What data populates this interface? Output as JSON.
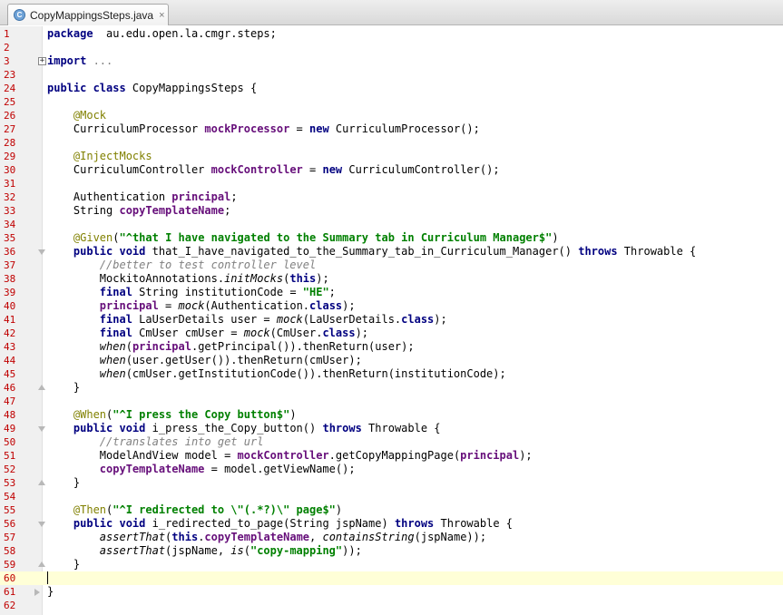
{
  "tab": {
    "icon_letter": "C",
    "title": "CopyMappingsSteps.java",
    "close_glyph": "×"
  },
  "colors": {
    "keyword": "#000080",
    "field": "#660e7a",
    "string": "#008000",
    "annotation": "#808000",
    "comment": "#808080",
    "line_number": "#c00000",
    "current_line": "#ffffd7"
  },
  "lines": [
    {
      "n": "1",
      "fold": "",
      "tokens": [
        [
          "kw",
          "package"
        ],
        [
          "",
          "  au.edu.open.la.cmgr.steps;"
        ]
      ]
    },
    {
      "n": "2",
      "fold": "",
      "tokens": []
    },
    {
      "n": "3",
      "fold": "plus",
      "tokens": [
        [
          "kw",
          "import"
        ],
        [
          "fold-text",
          " ..."
        ]
      ]
    },
    {
      "n": "23",
      "fold": "",
      "tokens": []
    },
    {
      "n": "24",
      "fold": "",
      "tokens": [
        [
          "kw",
          "public class"
        ],
        [
          "",
          " CopyMappingsSteps {"
        ]
      ]
    },
    {
      "n": "25",
      "fold": "",
      "tokens": []
    },
    {
      "n": "26",
      "fold": "",
      "tokens": [
        [
          "",
          "    "
        ],
        [
          "ann",
          "@Mock"
        ]
      ]
    },
    {
      "n": "27",
      "fold": "",
      "tokens": [
        [
          "",
          "    CurriculumProcessor "
        ],
        [
          "fld",
          "mockProcessor"
        ],
        [
          "",
          " = "
        ],
        [
          "kw",
          "new"
        ],
        [
          "",
          " CurriculumProcessor();"
        ]
      ]
    },
    {
      "n": "28",
      "fold": "",
      "tokens": []
    },
    {
      "n": "29",
      "fold": "",
      "tokens": [
        [
          "",
          "    "
        ],
        [
          "ann",
          "@InjectMocks"
        ]
      ]
    },
    {
      "n": "30",
      "fold": "",
      "tokens": [
        [
          "",
          "    CurriculumController "
        ],
        [
          "fld",
          "mockController"
        ],
        [
          "",
          " = "
        ],
        [
          "kw",
          "new"
        ],
        [
          "",
          " CurriculumController();"
        ]
      ]
    },
    {
      "n": "31",
      "fold": "",
      "tokens": []
    },
    {
      "n": "32",
      "fold": "",
      "tokens": [
        [
          "",
          "    Authentication "
        ],
        [
          "fld",
          "principal"
        ],
        [
          "",
          ";"
        ]
      ]
    },
    {
      "n": "33",
      "fold": "",
      "tokens": [
        [
          "",
          "    String "
        ],
        [
          "fld",
          "copyTemplateName"
        ],
        [
          "",
          ";"
        ]
      ]
    },
    {
      "n": "34",
      "fold": "",
      "tokens": []
    },
    {
      "n": "35",
      "fold": "",
      "tokens": [
        [
          "",
          "    "
        ],
        [
          "ann",
          "@Given"
        ],
        [
          "",
          "("
        ],
        [
          "str",
          "\"^that I have navigated to the Summary tab in Curriculum Manager$\""
        ],
        [
          "",
          ")"
        ]
      ]
    },
    {
      "n": "36",
      "fold": "open",
      "tokens": [
        [
          "",
          "    "
        ],
        [
          "kw",
          "public void"
        ],
        [
          "",
          " that_I_have_navigated_to_the_Summary_tab_in_Curriculum_Manager() "
        ],
        [
          "kw",
          "throws"
        ],
        [
          "",
          " Throwable {"
        ]
      ]
    },
    {
      "n": "37",
      "fold": "",
      "tokens": [
        [
          "",
          "        "
        ],
        [
          "cmt",
          "//better to test controller level"
        ]
      ]
    },
    {
      "n": "38",
      "fold": "",
      "tokens": [
        [
          "",
          "        MockitoAnnotations."
        ],
        [
          "it",
          "initMocks"
        ],
        [
          "",
          "("
        ],
        [
          "kw",
          "this"
        ],
        [
          "",
          ");"
        ]
      ]
    },
    {
      "n": "39",
      "fold": "",
      "tokens": [
        [
          "",
          "        "
        ],
        [
          "kw",
          "final"
        ],
        [
          "",
          " String institutionCode = "
        ],
        [
          "str",
          "\"HE\""
        ],
        [
          "",
          ";"
        ]
      ]
    },
    {
      "n": "40",
      "fold": "",
      "tokens": [
        [
          "",
          "        "
        ],
        [
          "fld",
          "principal"
        ],
        [
          "",
          " = "
        ],
        [
          "it",
          "mock"
        ],
        [
          "",
          "(Authentication."
        ],
        [
          "kw",
          "class"
        ],
        [
          "",
          ");"
        ]
      ]
    },
    {
      "n": "41",
      "fold": "",
      "tokens": [
        [
          "",
          "        "
        ],
        [
          "kw",
          "final"
        ],
        [
          "",
          " LaUserDetails user = "
        ],
        [
          "it",
          "mock"
        ],
        [
          "",
          "(LaUserDetails."
        ],
        [
          "kw",
          "class"
        ],
        [
          "",
          ");"
        ]
      ]
    },
    {
      "n": "42",
      "fold": "",
      "tokens": [
        [
          "",
          "        "
        ],
        [
          "kw",
          "final"
        ],
        [
          "",
          " CmUser cmUser = "
        ],
        [
          "it",
          "mock"
        ],
        [
          "",
          "(CmUser."
        ],
        [
          "kw",
          "class"
        ],
        [
          "",
          ");"
        ]
      ]
    },
    {
      "n": "43",
      "fold": "",
      "tokens": [
        [
          "",
          "        "
        ],
        [
          "it",
          "when"
        ],
        [
          "",
          "("
        ],
        [
          "fld",
          "principal"
        ],
        [
          "",
          ".getPrincipal()).thenReturn(user);"
        ]
      ]
    },
    {
      "n": "44",
      "fold": "",
      "tokens": [
        [
          "",
          "        "
        ],
        [
          "it",
          "when"
        ],
        [
          "",
          "(user.getUser()).thenReturn(cmUser);"
        ]
      ]
    },
    {
      "n": "45",
      "fold": "",
      "tokens": [
        [
          "",
          "        "
        ],
        [
          "it",
          "when"
        ],
        [
          "",
          "(cmUser.getInstitutionCode()).thenReturn(institutionCode);"
        ]
      ]
    },
    {
      "n": "46",
      "fold": "close",
      "tokens": [
        [
          "",
          "    }"
        ]
      ]
    },
    {
      "n": "47",
      "fold": "",
      "tokens": []
    },
    {
      "n": "48",
      "fold": "",
      "tokens": [
        [
          "",
          "    "
        ],
        [
          "ann",
          "@When"
        ],
        [
          "",
          "("
        ],
        [
          "str",
          "\"^I press the Copy button$\""
        ],
        [
          "",
          ")"
        ]
      ]
    },
    {
      "n": "49",
      "fold": "open",
      "tokens": [
        [
          "",
          "    "
        ],
        [
          "kw",
          "public void"
        ],
        [
          "",
          " i_press_the_Copy_button() "
        ],
        [
          "kw",
          "throws"
        ],
        [
          "",
          " Throwable {"
        ]
      ]
    },
    {
      "n": "50",
      "fold": "",
      "tokens": [
        [
          "",
          "        "
        ],
        [
          "cmt",
          "//translates into get url"
        ]
      ]
    },
    {
      "n": "51",
      "fold": "",
      "tokens": [
        [
          "",
          "        ModelAndView model = "
        ],
        [
          "fld",
          "mockController"
        ],
        [
          "",
          ".getCopyMappingPage("
        ],
        [
          "fld",
          "principal"
        ],
        [
          "",
          ");"
        ]
      ]
    },
    {
      "n": "52",
      "fold": "",
      "tokens": [
        [
          "",
          "        "
        ],
        [
          "fld",
          "copyTemplateName"
        ],
        [
          "",
          " = model.getViewName();"
        ]
      ]
    },
    {
      "n": "53",
      "fold": "close",
      "tokens": [
        [
          "",
          "    }"
        ]
      ]
    },
    {
      "n": "54",
      "fold": "",
      "tokens": []
    },
    {
      "n": "55",
      "fold": "",
      "tokens": [
        [
          "",
          "    "
        ],
        [
          "ann",
          "@Then"
        ],
        [
          "",
          "("
        ],
        [
          "str",
          "\"^I redirected to \\\"(.*?)\\\" page$\""
        ],
        [
          "",
          ")"
        ]
      ]
    },
    {
      "n": "56",
      "fold": "open",
      "tokens": [
        [
          "",
          "    "
        ],
        [
          "kw",
          "public void"
        ],
        [
          "",
          " i_redirected_to_page(String jspName) "
        ],
        [
          "kw",
          "throws"
        ],
        [
          "",
          " Throwable {"
        ]
      ]
    },
    {
      "n": "57",
      "fold": "",
      "tokens": [
        [
          "",
          "        "
        ],
        [
          "it",
          "assertThat"
        ],
        [
          "",
          "("
        ],
        [
          "kw",
          "this"
        ],
        [
          "",
          "."
        ],
        [
          "fld",
          "copyTemplateName"
        ],
        [
          "",
          ", "
        ],
        [
          "it",
          "containsString"
        ],
        [
          "",
          "(jspName));"
        ]
      ]
    },
    {
      "n": "58",
      "fold": "",
      "tokens": [
        [
          "",
          "        "
        ],
        [
          "it",
          "assertThat"
        ],
        [
          "",
          "(jspName, "
        ],
        [
          "it",
          "is"
        ],
        [
          "",
          "("
        ],
        [
          "str",
          "\"copy-mapping\""
        ],
        [
          "",
          "));"
        ]
      ]
    },
    {
      "n": "59",
      "fold": "close",
      "tokens": [
        [
          "",
          "    }"
        ]
      ]
    },
    {
      "n": "60",
      "fold": "",
      "current": true,
      "tokens": []
    },
    {
      "n": "61",
      "fold": "arrow",
      "tokens": [
        [
          "",
          "}"
        ]
      ]
    },
    {
      "n": "62",
      "fold": "",
      "tokens": []
    }
  ]
}
